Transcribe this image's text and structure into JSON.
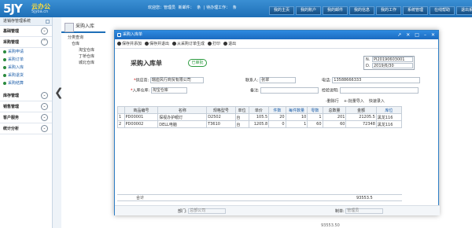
{
  "header": {
    "logo_main": "5JY",
    "logo_sub": "云办公",
    "logo_url": "5jyoa.cn",
    "welcome": [
      "欢迎您：管理员",
      "新邮件：",
      "条",
      "| 待办理工作：",
      "条"
    ],
    "nav": [
      "我的主页",
      "我的账户",
      "我的邮件",
      "我的信息",
      "我的工作",
      "系统管理",
      "在线帮助",
      "退出系统"
    ]
  },
  "sidebar": {
    "system_label": "进销存管理系统",
    "sections": [
      {
        "title": "基础管理",
        "items": []
      },
      {
        "title": "采购管理",
        "items": [
          "采购申请",
          "采购订单",
          "采购入库",
          "采购退货",
          "采购结算"
        ]
      },
      {
        "title": "库存管理",
        "items": []
      },
      {
        "title": "销售管理",
        "items": []
      },
      {
        "title": "客户服务",
        "items": []
      },
      {
        "title": "统计分析",
        "items": []
      }
    ]
  },
  "workspace": {
    "tab": "采购入库",
    "tree": [
      "分类查询",
      "仓库",
      "淘宝仓库",
      "丁桥仓库",
      "城北仓库"
    ],
    "bg_right": [
      "经办人",
      "经理员",
      "经理员"
    ],
    "bg_bottom": "93553.50"
  },
  "modal": {
    "title": "采购入库单",
    "window_buttons": [
      "↗",
      "✕",
      "□",
      "–",
      "✕"
    ],
    "toolbar": [
      "保存并添加",
      "保存并退出",
      "从采购订单生成",
      "打印",
      "退出"
    ],
    "form_title": "采购入库单",
    "stamp": "已审批",
    "no_label": "N.",
    "no_value": "PI20190603001",
    "date_label": "D.",
    "date_value": "2019/6/30",
    "supplier_label": "供应商:",
    "supplier_value": "瑞迪风行商贸有限公司",
    "contact_label": "联系人:",
    "contact_value": "张翠",
    "phone_label": "电话:",
    "phone_value": "13588666333",
    "warehouse_label": "入库仓库:",
    "warehouse_value": "淘宝仓库",
    "remark_label": "备注:",
    "inspect_label": "检验说明:",
    "table_tools": [
      "-删除行",
      "+-批量导入",
      "快速录入"
    ],
    "columns": [
      "",
      "商品编号",
      "名称",
      "规格型号",
      "单位",
      "单价",
      "件数",
      "每件数量",
      "零数",
      "总数量",
      "金额",
      "库位"
    ],
    "rows": [
      [
        "1",
        "PD00001",
        "探视办护眼灯",
        "D2502",
        "台",
        "105.5",
        "20",
        "10",
        "1",
        "201",
        "21205.5",
        "黑龙116"
      ],
      [
        "2",
        "PD00002",
        "DELL电脑",
        "T3610",
        "台",
        "1205.8",
        "0",
        "1",
        "60",
        "60",
        "72348",
        "黑龙116"
      ]
    ],
    "total_label": "合计",
    "total_value": "93553.5",
    "dept_label": "部门:",
    "dept_value": "总部公司",
    "maker_label": "制单:",
    "maker_value": "管理员"
  },
  "colors": {
    "header_blue": "#1e6fb7",
    "stamp_green": "#2b9a3e",
    "link_blue": "#1a5ca8"
  }
}
